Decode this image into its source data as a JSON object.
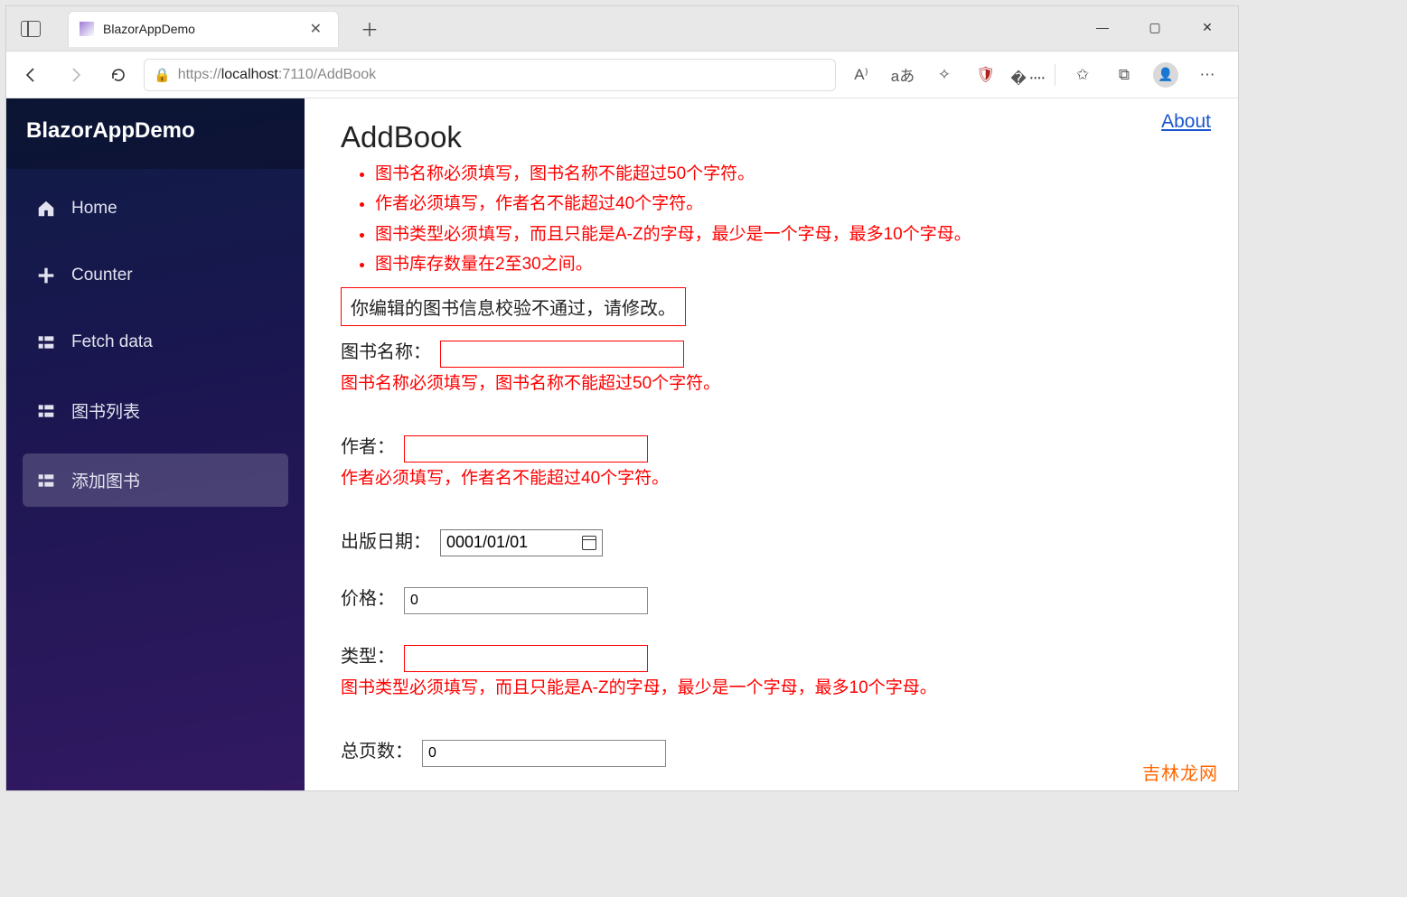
{
  "browser": {
    "tab_title": "BlazorAppDemo",
    "url_prefix": "https://",
    "url_host": "localhost",
    "url_port_path": ":7110/AddBook",
    "reader_icon": "A⁾",
    "translate_icon": "aあ"
  },
  "win": {
    "min": "—",
    "max": "▢",
    "close": "✕"
  },
  "sidebar": {
    "brand": "BlazorAppDemo",
    "items": [
      {
        "label": "Home"
      },
      {
        "label": "Counter"
      },
      {
        "label": "Fetch data"
      },
      {
        "label": "图书列表"
      },
      {
        "label": "添加图书"
      }
    ]
  },
  "header": {
    "about": "About"
  },
  "page": {
    "title": "AddBook",
    "summary_errors": [
      "图书名称必须填写，图书名称不能超过50个字符。",
      "作者必须填写，作者名不能超过40个字符。",
      "图书类型必须填写，而且只能是A-Z的字母，最少是一个字母，最多10个字母。",
      "图书库存数量在2至30之间。"
    ],
    "summary_box": "你编辑的图书信息校验不通过，请修改。",
    "fields": {
      "name": {
        "label": "图书名称：",
        "value": "",
        "error": "图书名称必须填写，图书名称不能超过50个字符。"
      },
      "author": {
        "label": "作者：",
        "value": "",
        "error": "作者必须填写，作者名不能超过40个字符。"
      },
      "date": {
        "label": "出版日期：",
        "value": "0001/01/01"
      },
      "price": {
        "label": "价格：",
        "value": "0"
      },
      "type": {
        "label": "类型：",
        "value": "",
        "error": "图书类型必须填写，而且只能是A-Z的字母，最少是一个字母，最多10个字母。"
      },
      "pages": {
        "label": "总页数：",
        "value": "0"
      }
    }
  },
  "watermark": "吉林龙网"
}
